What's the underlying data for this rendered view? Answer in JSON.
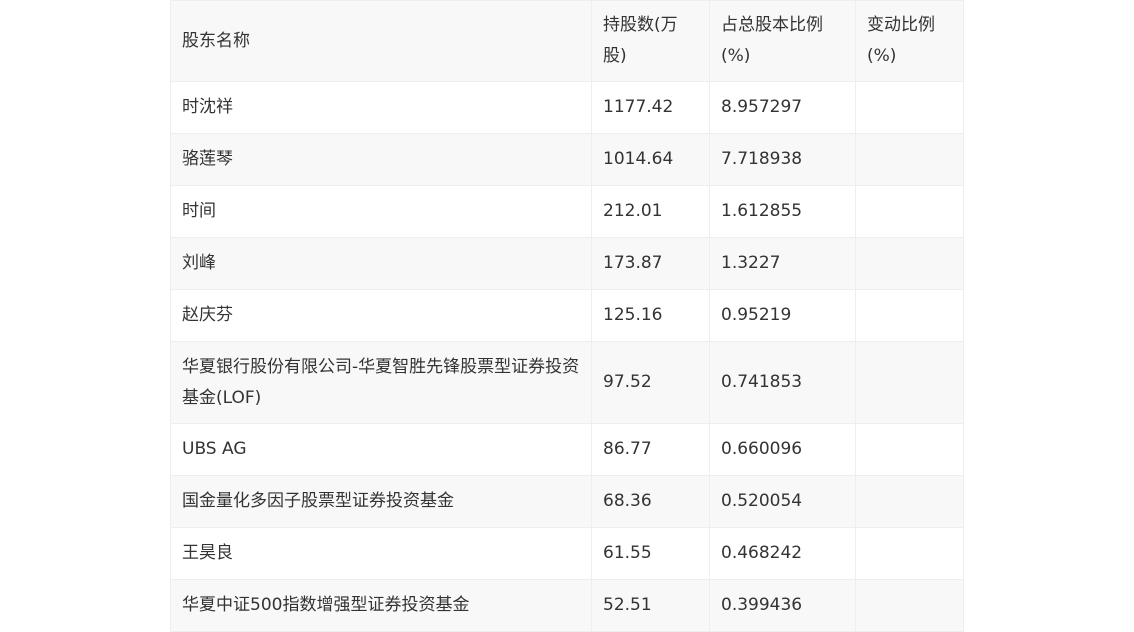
{
  "table": {
    "headers": [
      "股东名称",
      "持股数(万股)",
      "占总股本比例(%)",
      "变动比例(%)"
    ],
    "rows": [
      {
        "name": "时沈祥",
        "shares": "1177.42",
        "ratio": "8.957297",
        "change": ""
      },
      {
        "name": "骆莲琴",
        "shares": "1014.64",
        "ratio": "7.718938",
        "change": ""
      },
      {
        "name": "时间",
        "shares": "212.01",
        "ratio": "1.612855",
        "change": ""
      },
      {
        "name": "刘峰",
        "shares": "173.87",
        "ratio": "1.3227",
        "change": ""
      },
      {
        "name": "赵庆芬",
        "shares": "125.16",
        "ratio": "0.95219",
        "change": ""
      },
      {
        "name": "华夏银行股份有限公司-华夏智胜先锋股票型证券投资基金(LOF)",
        "shares": "97.52",
        "ratio": "0.741853",
        "change": ""
      },
      {
        "name": "UBS AG",
        "shares": "86.77",
        "ratio": "0.660096",
        "change": ""
      },
      {
        "name": "国金量化多因子股票型证券投资基金",
        "shares": "68.36",
        "ratio": "0.520054",
        "change": ""
      },
      {
        "name": "王昊良",
        "shares": "61.55",
        "ratio": "0.468242",
        "change": ""
      },
      {
        "name": "华夏中证500指数增强型证券投资基金",
        "shares": "52.51",
        "ratio": "0.399436",
        "change": ""
      }
    ]
  }
}
